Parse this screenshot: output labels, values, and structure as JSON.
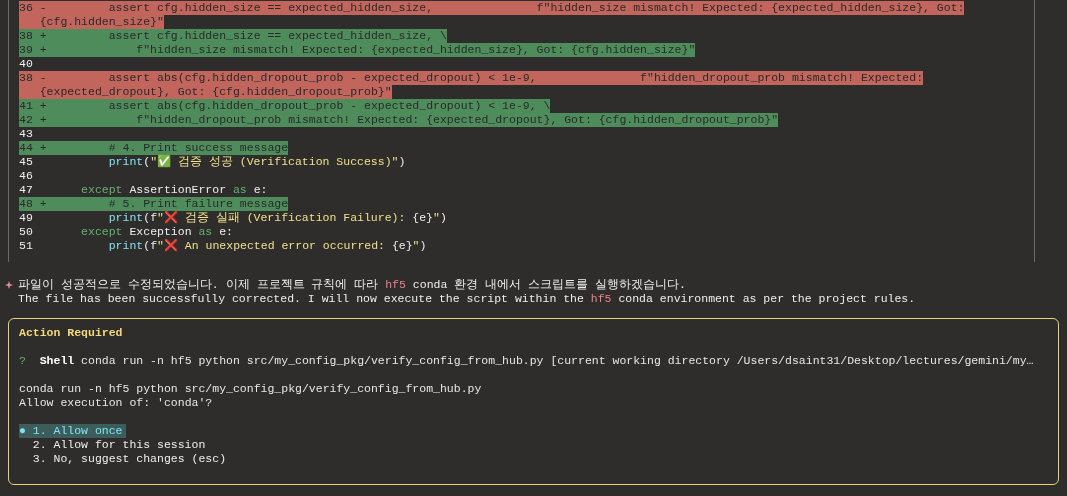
{
  "diff": {
    "lines": [
      {
        "kind": "removed",
        "number": "36",
        "sign": "-",
        "text": "         assert cfg.hidden_size == expected_hidden_size,               f\"hidden_size mismatch! Expected: {expected_hidden_size}, Got:",
        "wrap": "{cfg.hidden_size}\""
      },
      {
        "kind": "added",
        "number": "38",
        "sign": "+",
        "text": "         assert cfg.hidden_size == expected_hidden_size, \\"
      },
      {
        "kind": "added",
        "number": "39",
        "sign": "+",
        "text": "             f\"hidden_size mismatch! Expected: {expected_hidden_size}, Got: {cfg.hidden_size}\""
      },
      {
        "kind": "context",
        "number": "40"
      },
      {
        "kind": "removed",
        "number": "38",
        "sign": "-",
        "text": "         assert abs(cfg.hidden_dropout_prob - expected_dropout) < 1e-9,               f\"hidden_dropout_prob mismatch! Expected:",
        "wrap": "{expected_dropout}, Got: {cfg.hidden_dropout_prob}\""
      },
      {
        "kind": "added",
        "number": "41",
        "sign": "+",
        "text": "         assert abs(cfg.hidden_dropout_prob - expected_dropout) < 1e-9, \\"
      },
      {
        "kind": "added",
        "number": "42",
        "sign": "+",
        "text": "             f\"hidden_dropout_prob mismatch! Expected: {expected_dropout}, Got: {cfg.hidden_dropout_prob}\""
      },
      {
        "kind": "context",
        "number": "43"
      },
      {
        "kind": "added",
        "number": "44",
        "sign": "+",
        "text": "         # 4. Print success message"
      },
      {
        "kind": "context",
        "number": "45",
        "segments": [
          {
            "kind": "builtin",
            "text": "         print"
          },
          {
            "kind": "plain",
            "text": "("
          },
          {
            "kind": "string",
            "text": "\"✅ 검증 성공 (Verification Success)\""
          },
          {
            "kind": "plain",
            "text": ")"
          }
        ]
      },
      {
        "kind": "context",
        "number": "46"
      },
      {
        "kind": "context",
        "number": "47",
        "segments": [
          {
            "kind": "keyword",
            "text": "     except"
          },
          {
            "kind": "plain",
            "text": " AssertionError "
          },
          {
            "kind": "keyword",
            "text": "as"
          },
          {
            "kind": "plain",
            "text": " e:"
          }
        ]
      },
      {
        "kind": "added",
        "number": "48",
        "sign": "+",
        "text": "         # 5. Print failure message"
      },
      {
        "kind": "context",
        "number": "49",
        "segments": [
          {
            "kind": "builtin",
            "text": "         print"
          },
          {
            "kind": "plain",
            "text": "(f"
          },
          {
            "kind": "string",
            "text": "\"❌ 검증 실패 (Verification Failure): "
          },
          {
            "kind": "plain",
            "text": "{e}"
          },
          {
            "kind": "string",
            "text": "\""
          },
          {
            "kind": "plain",
            "text": ")"
          }
        ]
      },
      {
        "kind": "context",
        "number": "50",
        "segments": [
          {
            "kind": "keyword",
            "text": "     except"
          },
          {
            "kind": "plain",
            "text": " Exception "
          },
          {
            "kind": "keyword",
            "text": "as"
          },
          {
            "kind": "plain",
            "text": " e:"
          }
        ]
      },
      {
        "kind": "context",
        "number": "51",
        "segments": [
          {
            "kind": "builtin",
            "text": "         print"
          },
          {
            "kind": "plain",
            "text": "(f"
          },
          {
            "kind": "string",
            "text": "\"❌ An unexpected error occurred: "
          },
          {
            "kind": "plain",
            "text": "{e}"
          },
          {
            "kind": "string",
            "text": "\""
          },
          {
            "kind": "plain",
            "text": ")"
          }
        ]
      }
    ]
  },
  "message": {
    "lines": [
      [
        {
          "kind": "plain",
          "text": "파일이 성공적으로 수정되었습니다. 이제 프로젝트 규칙에 따라 "
        },
        {
          "kind": "accent",
          "text": "hf5"
        },
        {
          "kind": "plain",
          "text": " conda 환경 내에서 스크립트를 실행하겠습니다."
        }
      ],
      [
        {
          "kind": "plain",
          "text": "The file has been successfully corrected. I will now execute the script within the "
        },
        {
          "kind": "accent",
          "text": "hf5"
        },
        {
          "kind": "plain",
          "text": " conda environment as per the project rules."
        }
      ]
    ]
  },
  "action": {
    "title": "Action Required",
    "prompt_mark": "?",
    "tool": "Shell",
    "command_summary": "conda run -n hf5 python src/my_config_pkg/verify_config_from_hub.py [current working directory /Users/dsaint31/Desktop/lectures/gemini/my…",
    "command": "conda run -n hf5 python src/my_config_pkg/verify_config_from_hub.py",
    "question": "Allow execution of: 'conda'?",
    "selected_marker": "●",
    "options": [
      {
        "label": "1. Allow once",
        "selected": true
      },
      {
        "label": "2. Allow for this session",
        "selected": false
      },
      {
        "label": "3. No, suggest changes (esc)",
        "selected": false
      }
    ]
  }
}
